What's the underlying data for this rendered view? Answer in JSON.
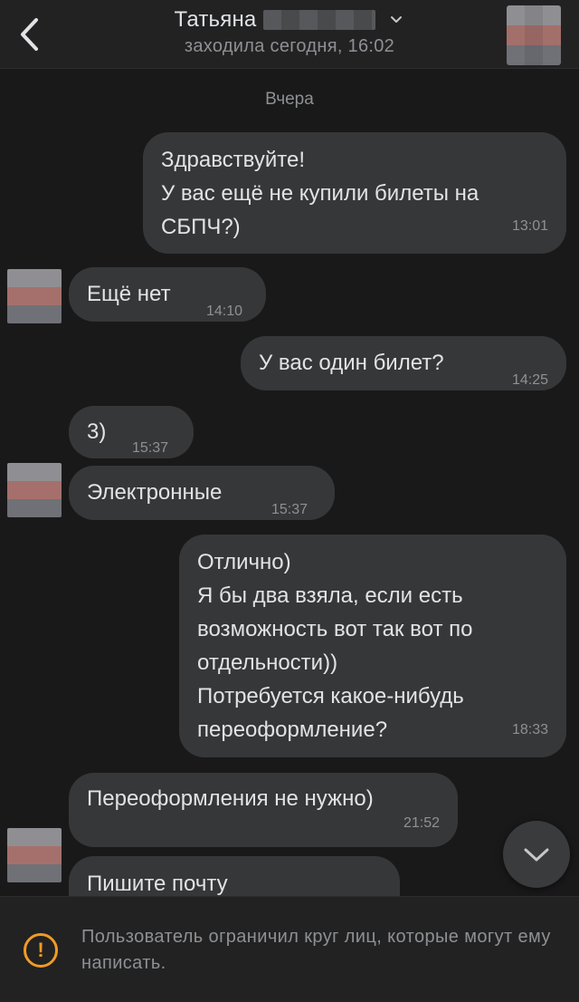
{
  "header": {
    "name": "Татьяна",
    "status": "заходила сегодня, 16:02"
  },
  "chat": {
    "date_label": "Вчера",
    "messages": [
      {
        "side": "out",
        "text": "Здравствуйте!\nУ вас ещё не купили билеты на СБПЧ?)",
        "time": "13:01"
      },
      {
        "side": "in",
        "text": "Ещё нет",
        "time": "14:10"
      },
      {
        "side": "out",
        "text": "У вас один билет?",
        "time": "14:25"
      },
      {
        "side": "in",
        "text": "3)",
        "time": "15:37"
      },
      {
        "side": "in",
        "text": "Электронные",
        "time": "15:37"
      },
      {
        "side": "out",
        "text": "Отлично)\nЯ бы два взяла, если есть возможность вот так вот по отдельности))\nПотребуется какое-нибудь переоформление?",
        "time": "18:33"
      },
      {
        "side": "in",
        "text": "Переоформления не нужно)",
        "time": "21:52"
      },
      {
        "side": "in",
        "text": "Пишите почту",
        "time": ""
      }
    ]
  },
  "footer": {
    "notice": "Пользователь ограничил круг лиц, которые могут ему написать."
  },
  "icons": {
    "back": "chevron-left-icon",
    "title_dropdown": "chevron-down-icon",
    "scroll_down": "chevron-down-icon",
    "notice": "exclamation-circle-icon"
  },
  "colors": {
    "background": "#19191a",
    "bubble": "#363738",
    "accent_warning": "#f29b24"
  }
}
